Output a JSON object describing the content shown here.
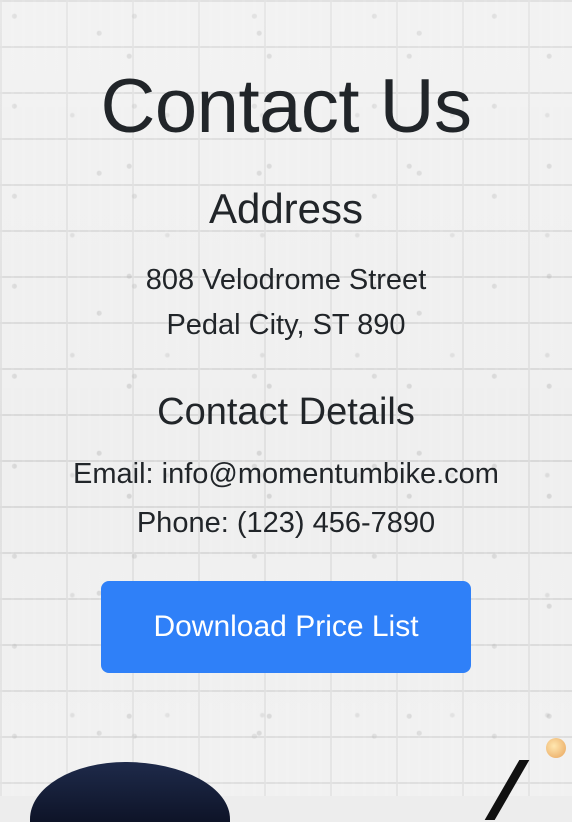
{
  "page": {
    "title": "Contact Us"
  },
  "address": {
    "heading": "Address",
    "line1": "808 Velodrome Street",
    "line2": "Pedal City, ST 890"
  },
  "contact": {
    "heading": "Contact Details",
    "email": "Email: info@momentumbike.com",
    "phone": "Phone: (123) 456-7890"
  },
  "actions": {
    "download_label": "Download Price List"
  },
  "colors": {
    "button": "#2f80f8",
    "text": "#212529",
    "background": "#eeeeee"
  }
}
